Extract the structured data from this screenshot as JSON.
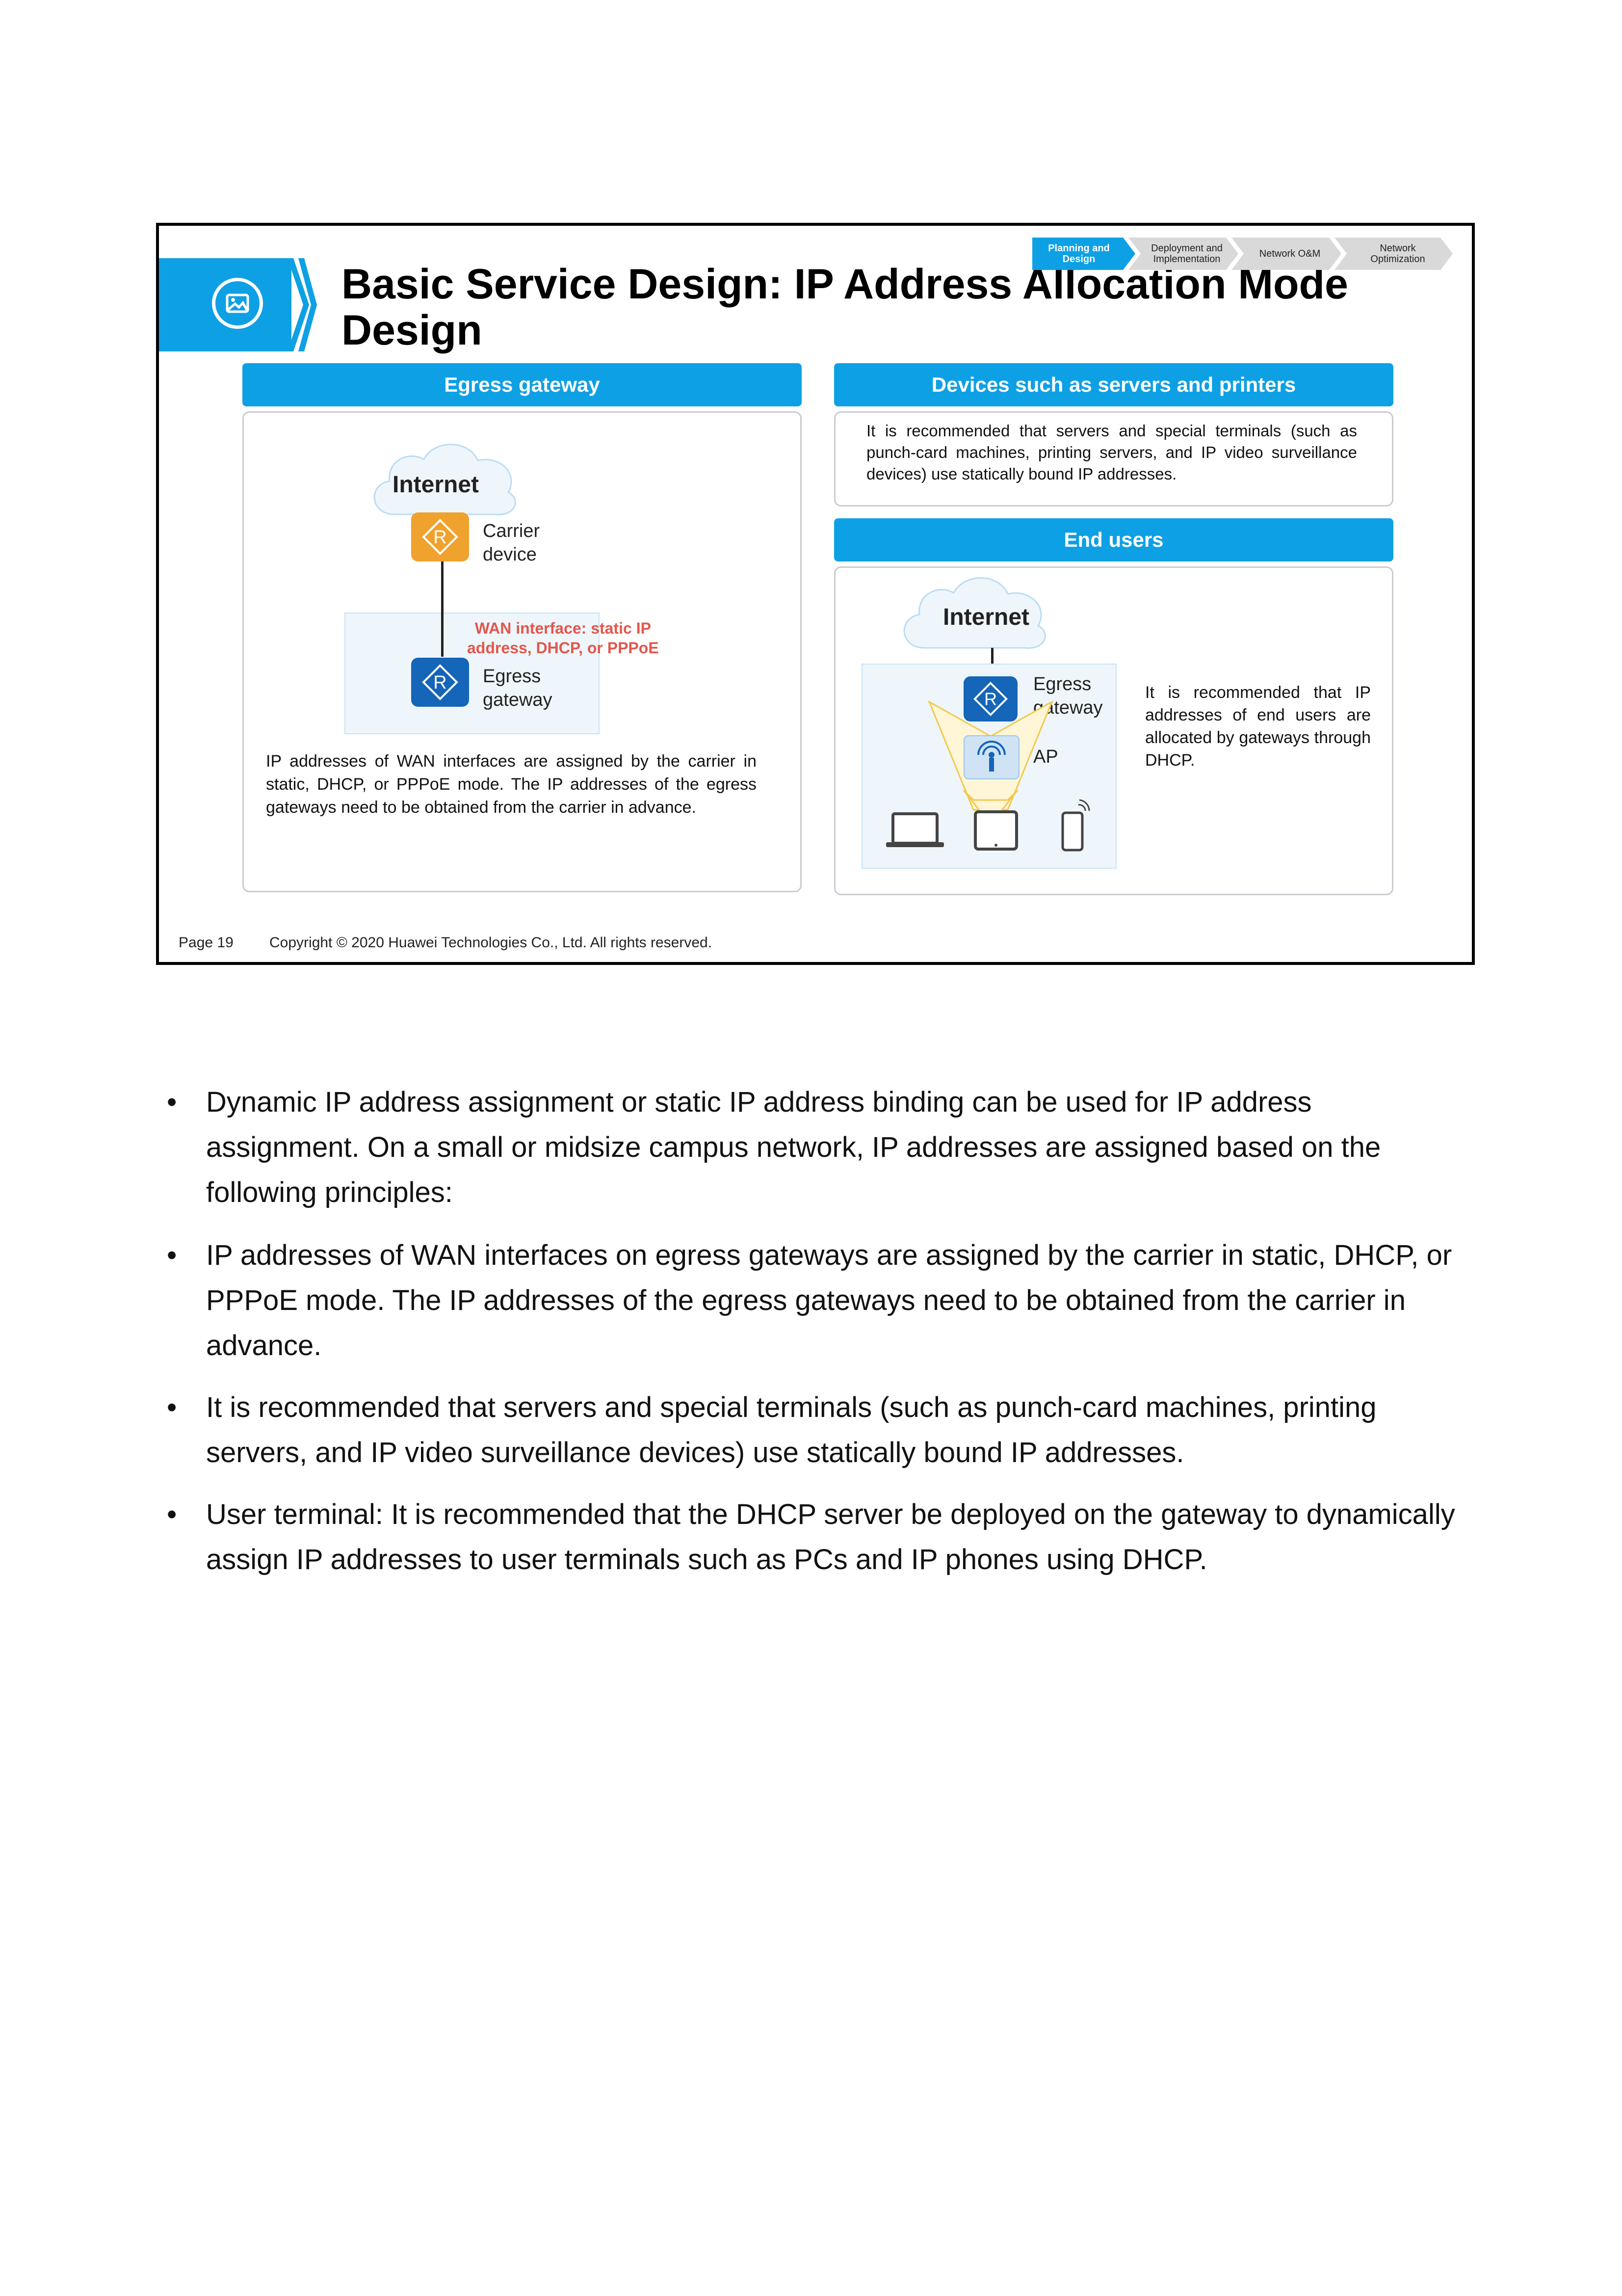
{
  "slide": {
    "title": "Basic Service Design: IP Address Allocation Mode Design",
    "progress": [
      {
        "line1": "Planning and",
        "line2": "Design",
        "active": true
      },
      {
        "line1": "Deployment and",
        "line2": "Implementation",
        "active": false
      },
      {
        "line1": "Network O&M",
        "line2": "",
        "active": false
      },
      {
        "line1": "Network",
        "line2": "Optimization",
        "active": false
      }
    ],
    "egress": {
      "header": "Egress gateway",
      "cloud": "Internet",
      "carrier_label_1": "Carrier",
      "carrier_label_2": "device",
      "wan_line1": "WAN interface: static IP",
      "wan_line2": "address, DHCP, or PPPoE",
      "gateway_label_1": "Egress",
      "gateway_label_2": "gateway",
      "router_glyph": "R",
      "description": "IP addresses of WAN interfaces are assigned by the carrier in static, DHCP, or PPPoE mode. The IP addresses of the egress gateways need to be obtained from the carrier in advance."
    },
    "devices": {
      "header": "Devices such as servers and printers",
      "description": "It is recommended that servers and special terminals (such as punch-card machines, printing servers, and IP video surveillance devices) use statically bound IP addresses."
    },
    "end_users": {
      "header": "End users",
      "cloud": "Internet",
      "gateway_label_1": "Egress",
      "gateway_label_2": "gateway",
      "ap_label": "AP",
      "description": "It is recommended that IP addresses of end users are allocated by gateways through DHCP."
    },
    "footer": {
      "page": "Page 19",
      "copyright": "Copyright © 2020 Huawei Technologies Co., Ltd. All rights reserved."
    }
  },
  "bullets": [
    {
      "marker": "•",
      "text": "Dynamic IP address assignment or static IP address binding can be used for IP address assignment. On a small or midsize campus network, IP addresses are assigned based on the following principles:"
    },
    {
      "marker": "•",
      "text": "IP addresses of WAN interfaces on egress gateways are assigned by the carrier in static, DHCP, or PPPoE mode. The IP addresses of the egress gateways need to be obtained from the carrier in advance."
    },
    {
      "marker": "•",
      "text": "It is recommended that servers and special terminals (such as punch-card machines, printing servers, and IP video surveillance devices) use statically bound IP addresses."
    },
    {
      "marker": "•",
      "text": "User terminal: It is recommended that the DHCP server be deployed on the gateway to dynamically assign IP addresses to user terminals such as PCs and IP phones using DHCP."
    }
  ],
  "colors": {
    "accent": "#0ea0e4",
    "carrier_router": "#f0a22e",
    "gateway_router": "#1565b8",
    "wan_text": "#e2574c"
  }
}
